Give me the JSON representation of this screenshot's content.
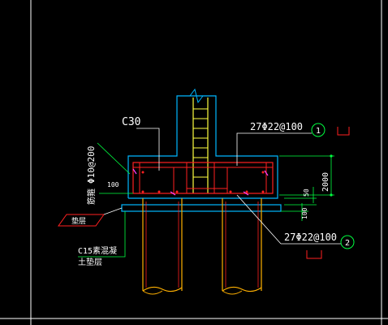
{
  "drawing": {
    "concrete_grade": "C30",
    "top_rebar": "27Φ22@100",
    "bottom_rebar": "27Φ22@100",
    "stirrup": "Φ10@200",
    "stirrup_prefix": "筋箍",
    "callout_1": "1",
    "callout_2": "2",
    "dim_height": "2000",
    "dim_50": "50",
    "dim_100_left": "100",
    "dim_100_right": "100",
    "cushion_line1": "C15素混凝",
    "cushion_line2": "土垫层",
    "tag_label": "垫层"
  },
  "colors": {
    "background": "#000000",
    "footing_outline": "#00b7ff",
    "rebar": "#ff2020",
    "pile": "#ffb000",
    "column": "#ffff40",
    "leader": "#00ff40",
    "text": "#ffffff",
    "magenta": "#ff40ff"
  }
}
